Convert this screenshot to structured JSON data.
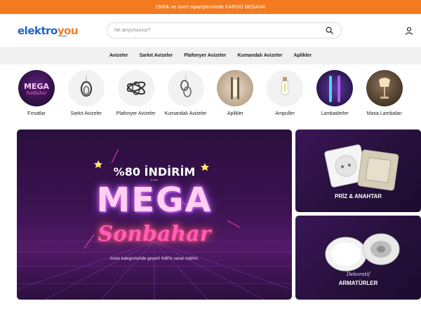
{
  "announcement": "1500₺ ve üzeri siparişlerinizde KARGO BEDAVA!",
  "logo": {
    "part1": "elektro",
    "part2": "you",
    "suffix": ".com"
  },
  "search": {
    "placeholder": "Ne arıyorsunuz?"
  },
  "nav": [
    "Avizeler",
    "Sarkıt Avizeler",
    "Plafonyer Avizeler",
    "Kumandalı Avizeler",
    "Aplikler"
  ],
  "categories": [
    {
      "label": "Fırsatlar",
      "icon": "mega-badge-icon"
    },
    {
      "label": "Sarkıt Avizeler",
      "icon": "pendant-chandelier-icon"
    },
    {
      "label": "Plafonyer Avizeler",
      "icon": "ceiling-light-icon"
    },
    {
      "label": "Kumandalı Avizeler",
      "icon": "remote-chandelier-icon"
    },
    {
      "label": "Aplikler",
      "icon": "wall-lamp-icon"
    },
    {
      "label": "Ampuller",
      "icon": "bulb-icon"
    },
    {
      "label": "Lambaderler",
      "icon": "floor-lamp-icon"
    },
    {
      "label": "Masa Lambaları",
      "icon": "table-lamp-icon"
    }
  ],
  "banner": {
    "discount": "%80 İNDİRİM",
    "small_text": "E varan",
    "mega": "MEGA",
    "script": "Sonbahar",
    "description": "Avize kategorisinde geçerli %80'e varan indirim."
  },
  "side_banners": [
    {
      "label": "PRİZ & ANAHTAR"
    },
    {
      "script": "Dekoratif",
      "label": "ARMATÜRLER"
    }
  ],
  "colors": {
    "accent": "#f47a20",
    "brand_blue": "#1e66c9",
    "nav_bg": "#f1f1f1",
    "banner_purple": "#3b1250"
  }
}
